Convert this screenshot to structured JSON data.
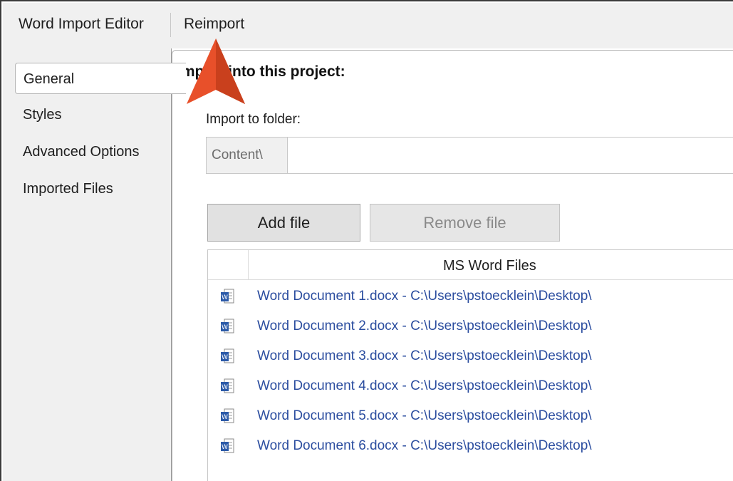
{
  "toolbar": {
    "editor_label": "Word Import Editor",
    "reimport_label": "Reimport"
  },
  "sidebar": {
    "items": [
      {
        "label": "General",
        "active": true
      },
      {
        "label": "Styles"
      },
      {
        "label": "Advanced Options"
      },
      {
        "label": "Imported Files"
      }
    ]
  },
  "main": {
    "section_title": "Import into this project:",
    "folder_label": "Import to folder:",
    "folder_prefix": "Content\\",
    "folder_value": "",
    "add_file_label": "Add file",
    "remove_file_label": "Remove file",
    "list_header": "MS Word Files",
    "files": [
      "Word Document 1.docx - C:\\Users\\pstoecklein\\Desktop\\",
      "Word Document 2.docx - C:\\Users\\pstoecklein\\Desktop\\",
      "Word Document 3.docx - C:\\Users\\pstoecklein\\Desktop\\",
      "Word Document 4.docx - C:\\Users\\pstoecklein\\Desktop\\",
      "Word Document 5.docx - C:\\Users\\pstoecklein\\Desktop\\",
      "Word Document 6.docx - C:\\Users\\pstoecklein\\Desktop\\"
    ]
  },
  "icons": {
    "file_icon": "word-document-icon",
    "callout": "arrow-up-icon"
  },
  "colors": {
    "callout": "#e8502a",
    "link_text": "#2b4d9f"
  }
}
